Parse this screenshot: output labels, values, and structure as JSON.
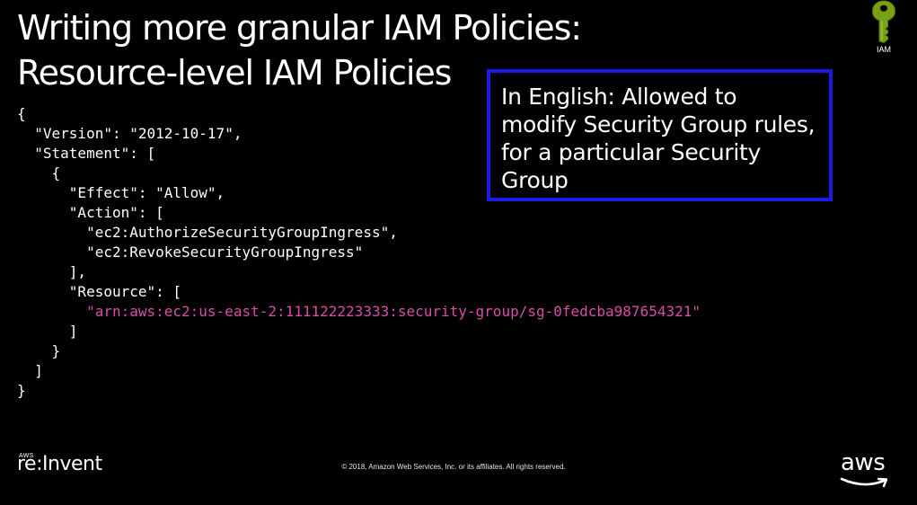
{
  "slide": {
    "title_line1": "Writing more granular IAM Policies:",
    "title_line2": "Resource-level IAM Policies"
  },
  "badge": {
    "icon": "iam-key-icon",
    "label": "IAM",
    "color": "#7aa116"
  },
  "callout": {
    "text": "In English: Allowed to modify Security Group rules, for a particular Security Group",
    "border_color": "#1a1ae6"
  },
  "policy": {
    "lines": [
      "{",
      "  \"Version\": \"2012-10-17\",",
      "  \"Statement\": [",
      "    {",
      "      \"Effect\": \"Allow\",",
      "      \"Action\": [",
      "        \"ec2:AuthorizeSecurityGroupIngress\",",
      "        \"ec2:RevokeSecurityGroupIngress\"",
      "      ],",
      "      \"Resource\": [",
      "        \"arn:aws:ec2:us-east-2:111122223333:security-group/sg-0fedcba987654321\"",
      "      ]",
      "    }",
      "  ]",
      "}"
    ],
    "highlight_line": 10,
    "highlight_color": "#d54fa7"
  },
  "footer": {
    "event_small": "AWS",
    "event_main": "re:Invent",
    "copyright": "© 2018, Amazon Web Services, Inc. or its affiliates. All rights reserved.",
    "logo_text": "aws",
    "logo_icon": "aws-smile-icon"
  }
}
